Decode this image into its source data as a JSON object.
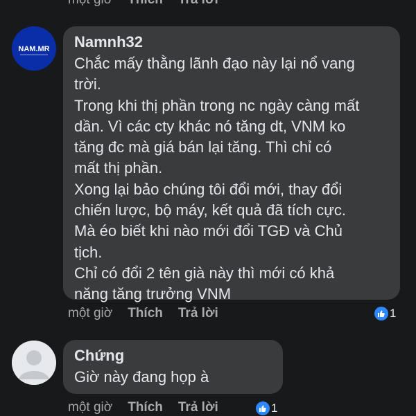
{
  "top_actions": {
    "time": "một giờ",
    "like": "Thích",
    "reply": "Trả lời"
  },
  "comments": [
    {
      "author": "Namnh32",
      "avatar_text": "NAM.MR",
      "text": "Chắc mấy thằng lãnh đạo này lại nổ vang\ntrời.\nTrong khi thị phần trong nc ngày càng mất\ndần. Vì các cty khác nó tăng dt, VNM ko\ntăng đc mà giá bán lại tăng. Thì chỉ có\nmất thị phần.\nXong lại bảo chúng tôi đổi mới, thay đổi\nchiến lược, bộ máy, kết quả đã tích cực.\nMà éo biết khi nào mới đổi TGĐ và Chủ\ntịch.\nChỉ có đổi 2 tên già này thì mới có khả\nnăng tăng trưởng VNM",
      "time": "một giờ",
      "like": "Thích",
      "reply": "Trả lời",
      "reaction_count": "1"
    },
    {
      "author": "Chứng",
      "text": "Giờ này đang họp à",
      "time": "một giờ",
      "like": "Thích",
      "reply": "Trả lời",
      "reaction_count": "1"
    }
  ],
  "colors": {
    "background": "#18191a",
    "bubble": "#3a3b3c",
    "like_blue": "#2d88ff",
    "avatar_navy": "#0a2ea8"
  }
}
